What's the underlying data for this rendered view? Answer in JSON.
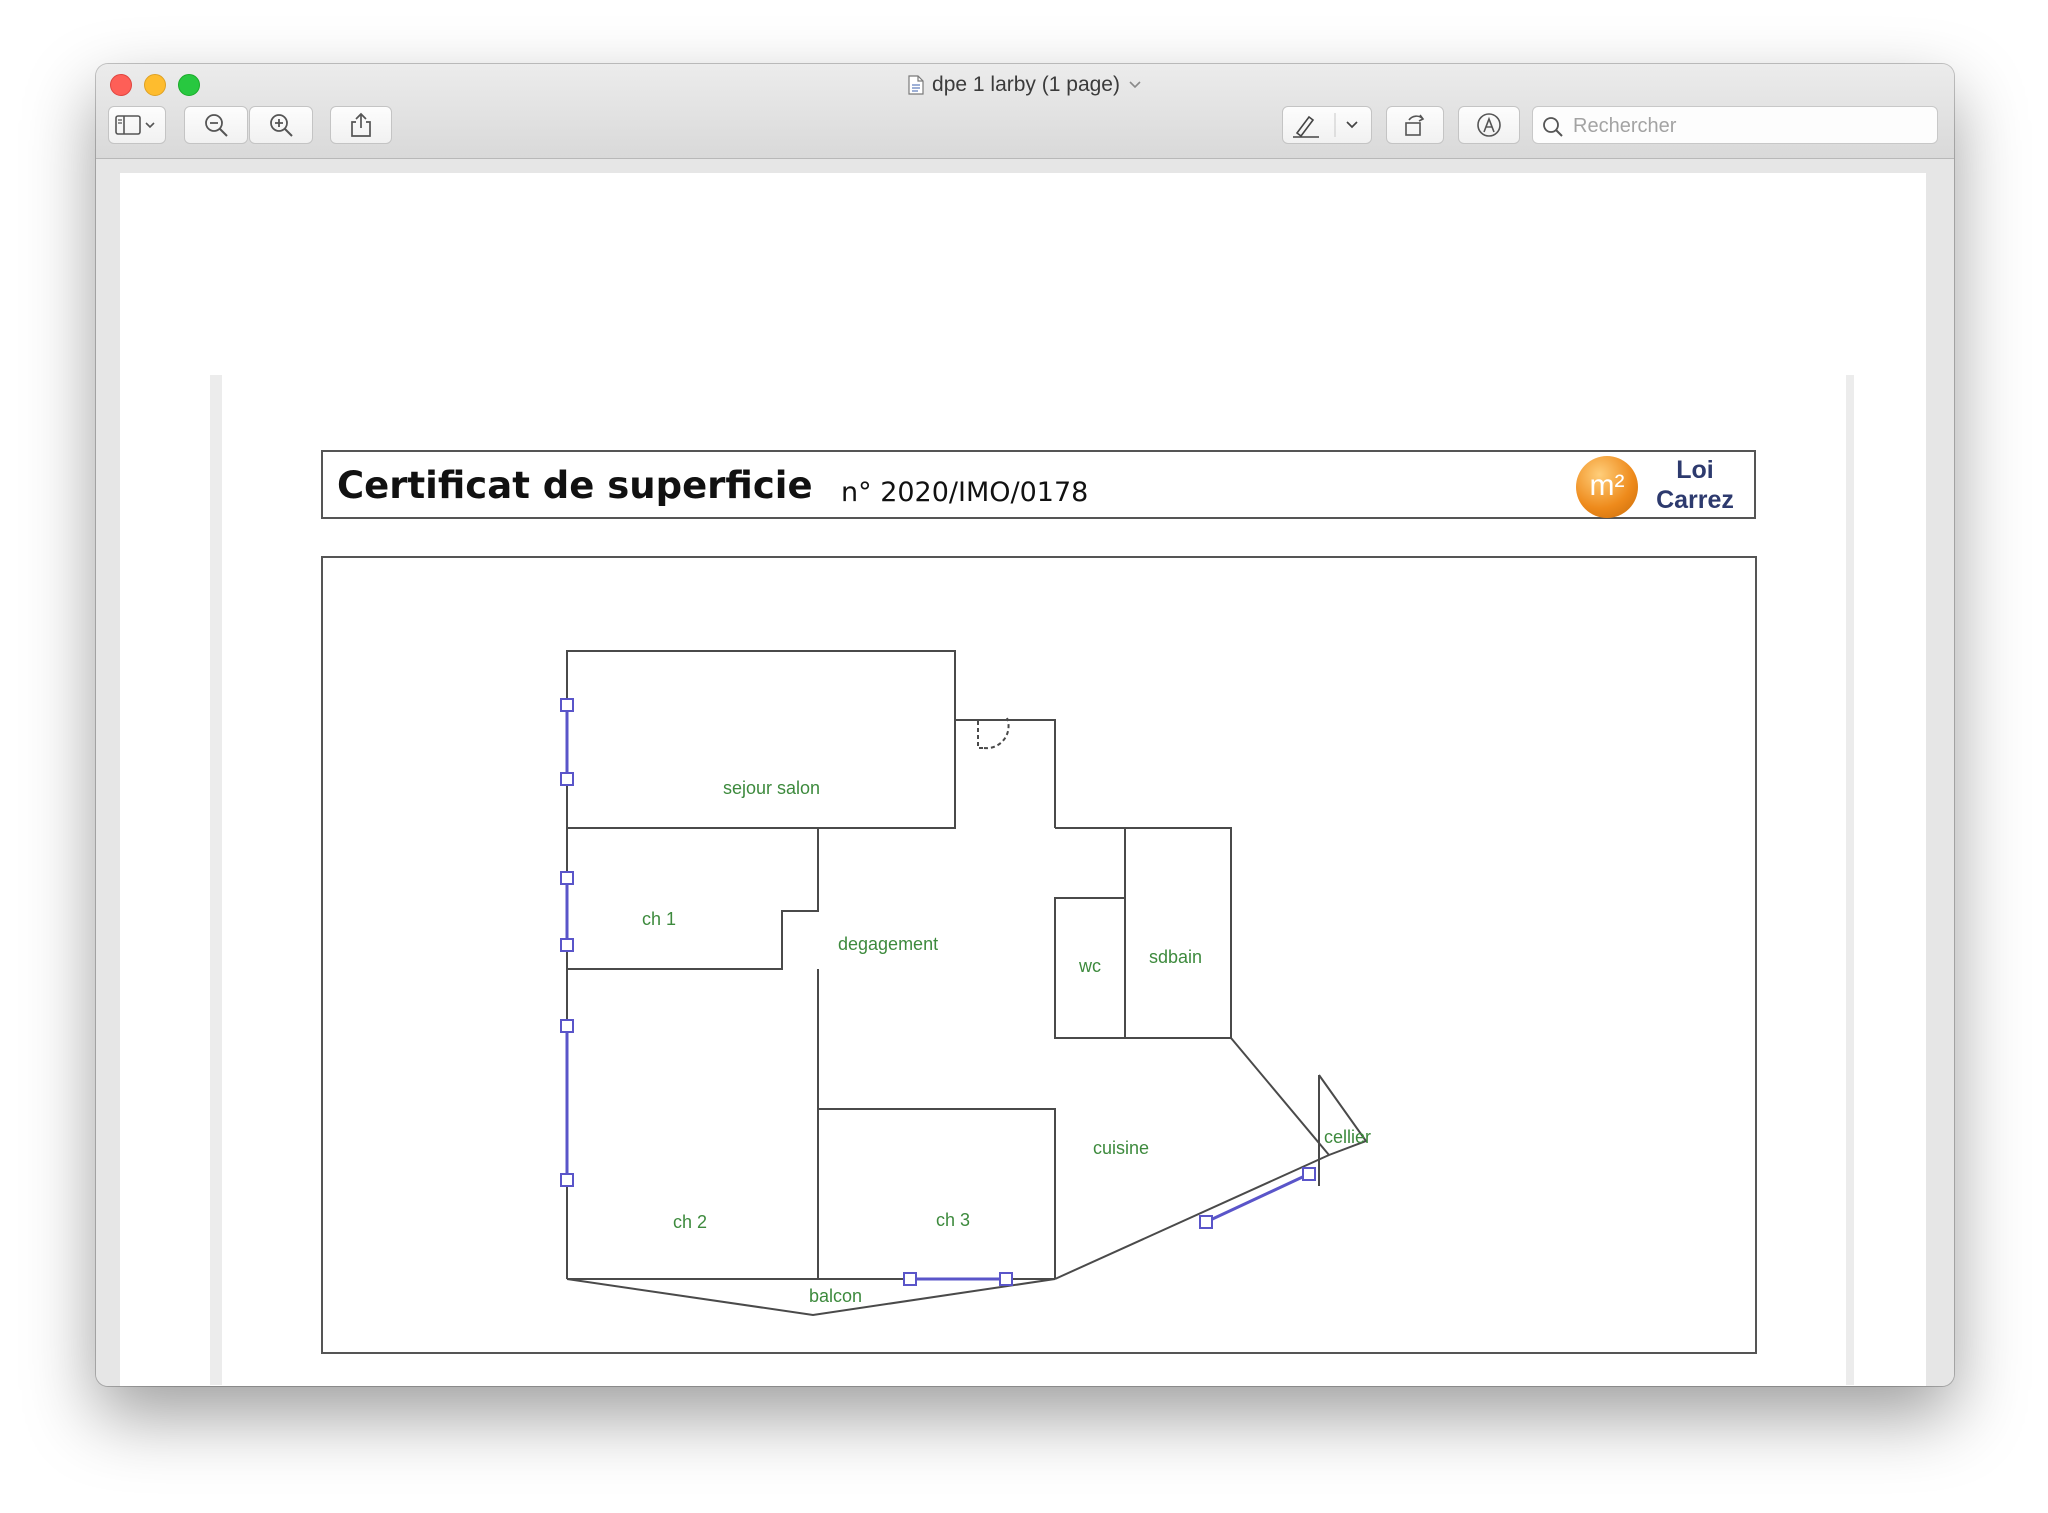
{
  "window": {
    "title": "dpe 1 larby (1 page)",
    "search_placeholder": "Rechercher"
  },
  "toolbar": {
    "icons": [
      "sidebar-icon",
      "zoom-out-icon",
      "zoom-in-icon",
      "share-icon",
      "markup-pen-icon",
      "rotate-icon",
      "annotate-icon",
      "search-icon"
    ]
  },
  "document": {
    "title": "Certificat de superficie",
    "number": "n° 2020/IMO/0178",
    "logo_text": "m²",
    "logo_label_line1": "Loi",
    "logo_label_line2": "Carrez"
  },
  "floor_plan": {
    "rooms": {
      "sejour_salon": "sejour salon",
      "ch1": "ch 1",
      "degagement": "degagement",
      "wc": "wc",
      "sdbain": "sdbain",
      "cuisine": "cuisine",
      "cellier": "cellier",
      "ch2": "ch 2",
      "ch3": "ch 3",
      "balcon": "balcon"
    }
  },
  "colors": {
    "room_label": "#3d8a3d",
    "window_line": "#5a55c9",
    "logo_orange": "#ee8a1b",
    "logo_text_navy": "#2d3a6e"
  }
}
